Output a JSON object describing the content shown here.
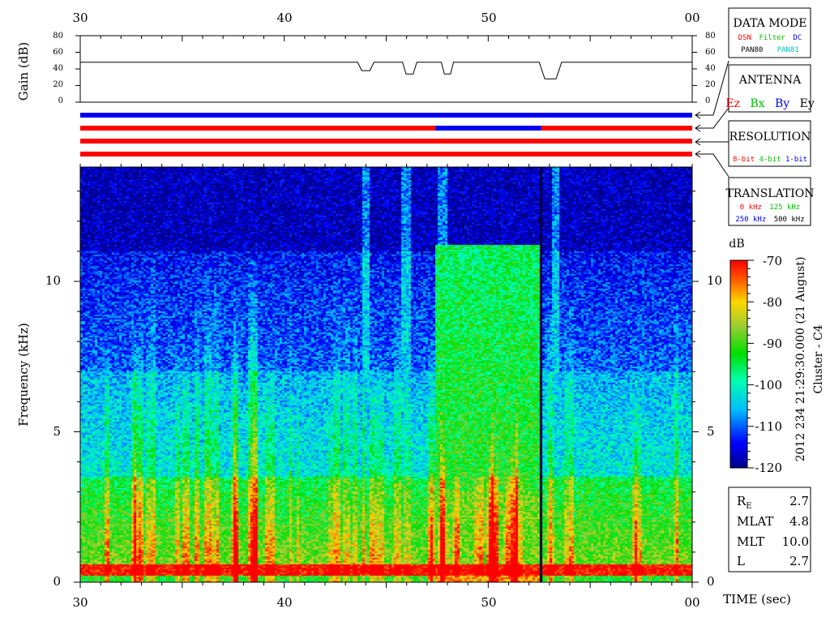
{
  "chart_data": {
    "type": "heatmap",
    "figure_labels": {
      "spacecraft": "Cluster - C4",
      "timestamp": "2012 234 21:29:30.000 (21 August)"
    },
    "time_axis": {
      "label": "TIME (sec)",
      "ticks": [
        "30",
        "40",
        "50",
        "00"
      ],
      "range_sec": [
        30,
        60
      ]
    },
    "gain_panel": {
      "ylabel": "Gain (dB)",
      "ylim": [
        0,
        80
      ],
      "ticks": [
        "0",
        "20",
        "40",
        "60",
        "80"
      ],
      "baseline_db": 48,
      "dips": [
        {
          "t_start": 43.6,
          "t_end": 44.4,
          "min_db": 38
        },
        {
          "t_start": 45.8,
          "t_end": 46.5,
          "min_db": 34
        },
        {
          "t_start": 47.7,
          "t_end": 48.3,
          "min_db": 34
        },
        {
          "t_start": 52.5,
          "t_end": 53.6,
          "min_db": 28
        }
      ]
    },
    "status_bars": [
      {
        "name": "DATA MODE",
        "segments": [
          {
            "t0": 30,
            "t1": 60,
            "color": "#0000ee"
          }
        ]
      },
      {
        "name": "ANTENNA",
        "segments": [
          {
            "t0": 30,
            "t1": 47.4,
            "color": "#ff0000"
          },
          {
            "t0": 47.4,
            "t1": 52.6,
            "color": "#0000ee"
          },
          {
            "t0": 52.6,
            "t1": 60,
            "color": "#ff0000"
          }
        ]
      },
      {
        "name": "RESOLUTION",
        "segments": [
          {
            "t0": 30,
            "t1": 60,
            "color": "#ff0000"
          }
        ]
      },
      {
        "name": "TRANSLATION",
        "segments": [
          {
            "t0": 30,
            "t1": 60,
            "color": "#ff0000"
          }
        ]
      }
    ],
    "spectrogram": {
      "ylabel": "Frequency (kHz)",
      "ylim": [
        0,
        13.8
      ],
      "yticks": [
        "0",
        "5",
        "10"
      ],
      "description_bands": [
        {
          "f_low": 0.2,
          "f_high": 0.6,
          "level_db": -70
        },
        {
          "f_low": 0.6,
          "f_high": 3.5,
          "level_db": -88
        },
        {
          "f_low": 3.5,
          "f_high": 7,
          "level_db": -102
        },
        {
          "f_low": 7,
          "f_high": 11,
          "level_db": -110
        },
        {
          "f_low": 11,
          "f_high": 13.8,
          "level_db": -118
        }
      ],
      "enhanced_interval": {
        "t_start": 47.4,
        "t_end": 52.6,
        "f_high": 11.2,
        "level_db": -90
      },
      "data_gap": {
        "t": 52.6
      },
      "broadband_bursts": [
        44,
        46,
        47.8,
        53.3
      ]
    },
    "colorbar": {
      "unit": "dB",
      "range": [
        -120,
        -70
      ],
      "ticks": [
        "-70",
        "-80",
        "-90",
        "-100",
        "-110",
        "-120"
      ]
    }
  },
  "legend": {
    "data_mode": {
      "title": "DATA MODE",
      "line1": [
        {
          "text": "DSN",
          "color": "#ff0000"
        },
        {
          "text": "Filter",
          "color": "#00c000"
        },
        {
          "text": "DC",
          "color": "#0000ee"
        }
      ],
      "line2": [
        {
          "text": "PAN80",
          "color": "#000000"
        },
        {
          "text": "PAN81",
          "color": "#00c0c0"
        }
      ]
    },
    "antenna": {
      "title": "ANTENNA",
      "items": [
        {
          "text": "Ez",
          "color": "#ff0000"
        },
        {
          "text": "Bx",
          "color": "#00c000"
        },
        {
          "text": "By",
          "color": "#0000ee"
        },
        {
          "text": "Ey",
          "color": "#000000"
        }
      ]
    },
    "resolution": {
      "title": "RESOLUTION",
      "items": [
        {
          "text": "8-bit",
          "color": "#ff0000"
        },
        {
          "text": "4-bit",
          "color": "#00c000"
        },
        {
          "text": "1-bit",
          "color": "#0000ee"
        }
      ]
    },
    "translation": {
      "title": "TRANSLATION",
      "line1": [
        {
          "text": "0 kHz",
          "color": "#ff0000"
        },
        {
          "text": "125 kHz",
          "color": "#00c000"
        }
      ],
      "line2": [
        {
          "text": "250 kHz",
          "color": "#0000ee"
        },
        {
          "text": "500 kHz",
          "color": "#000000"
        }
      ]
    }
  },
  "orbit": {
    "rows": [
      {
        "label": "R",
        "sub": "E",
        "value": "2.7"
      },
      {
        "label": "MLAT",
        "sub": "",
        "value": "4.8"
      },
      {
        "label": "MLT",
        "sub": "",
        "value": "10.0"
      },
      {
        "label": "L",
        "sub": "",
        "value": "2.7"
      }
    ]
  }
}
